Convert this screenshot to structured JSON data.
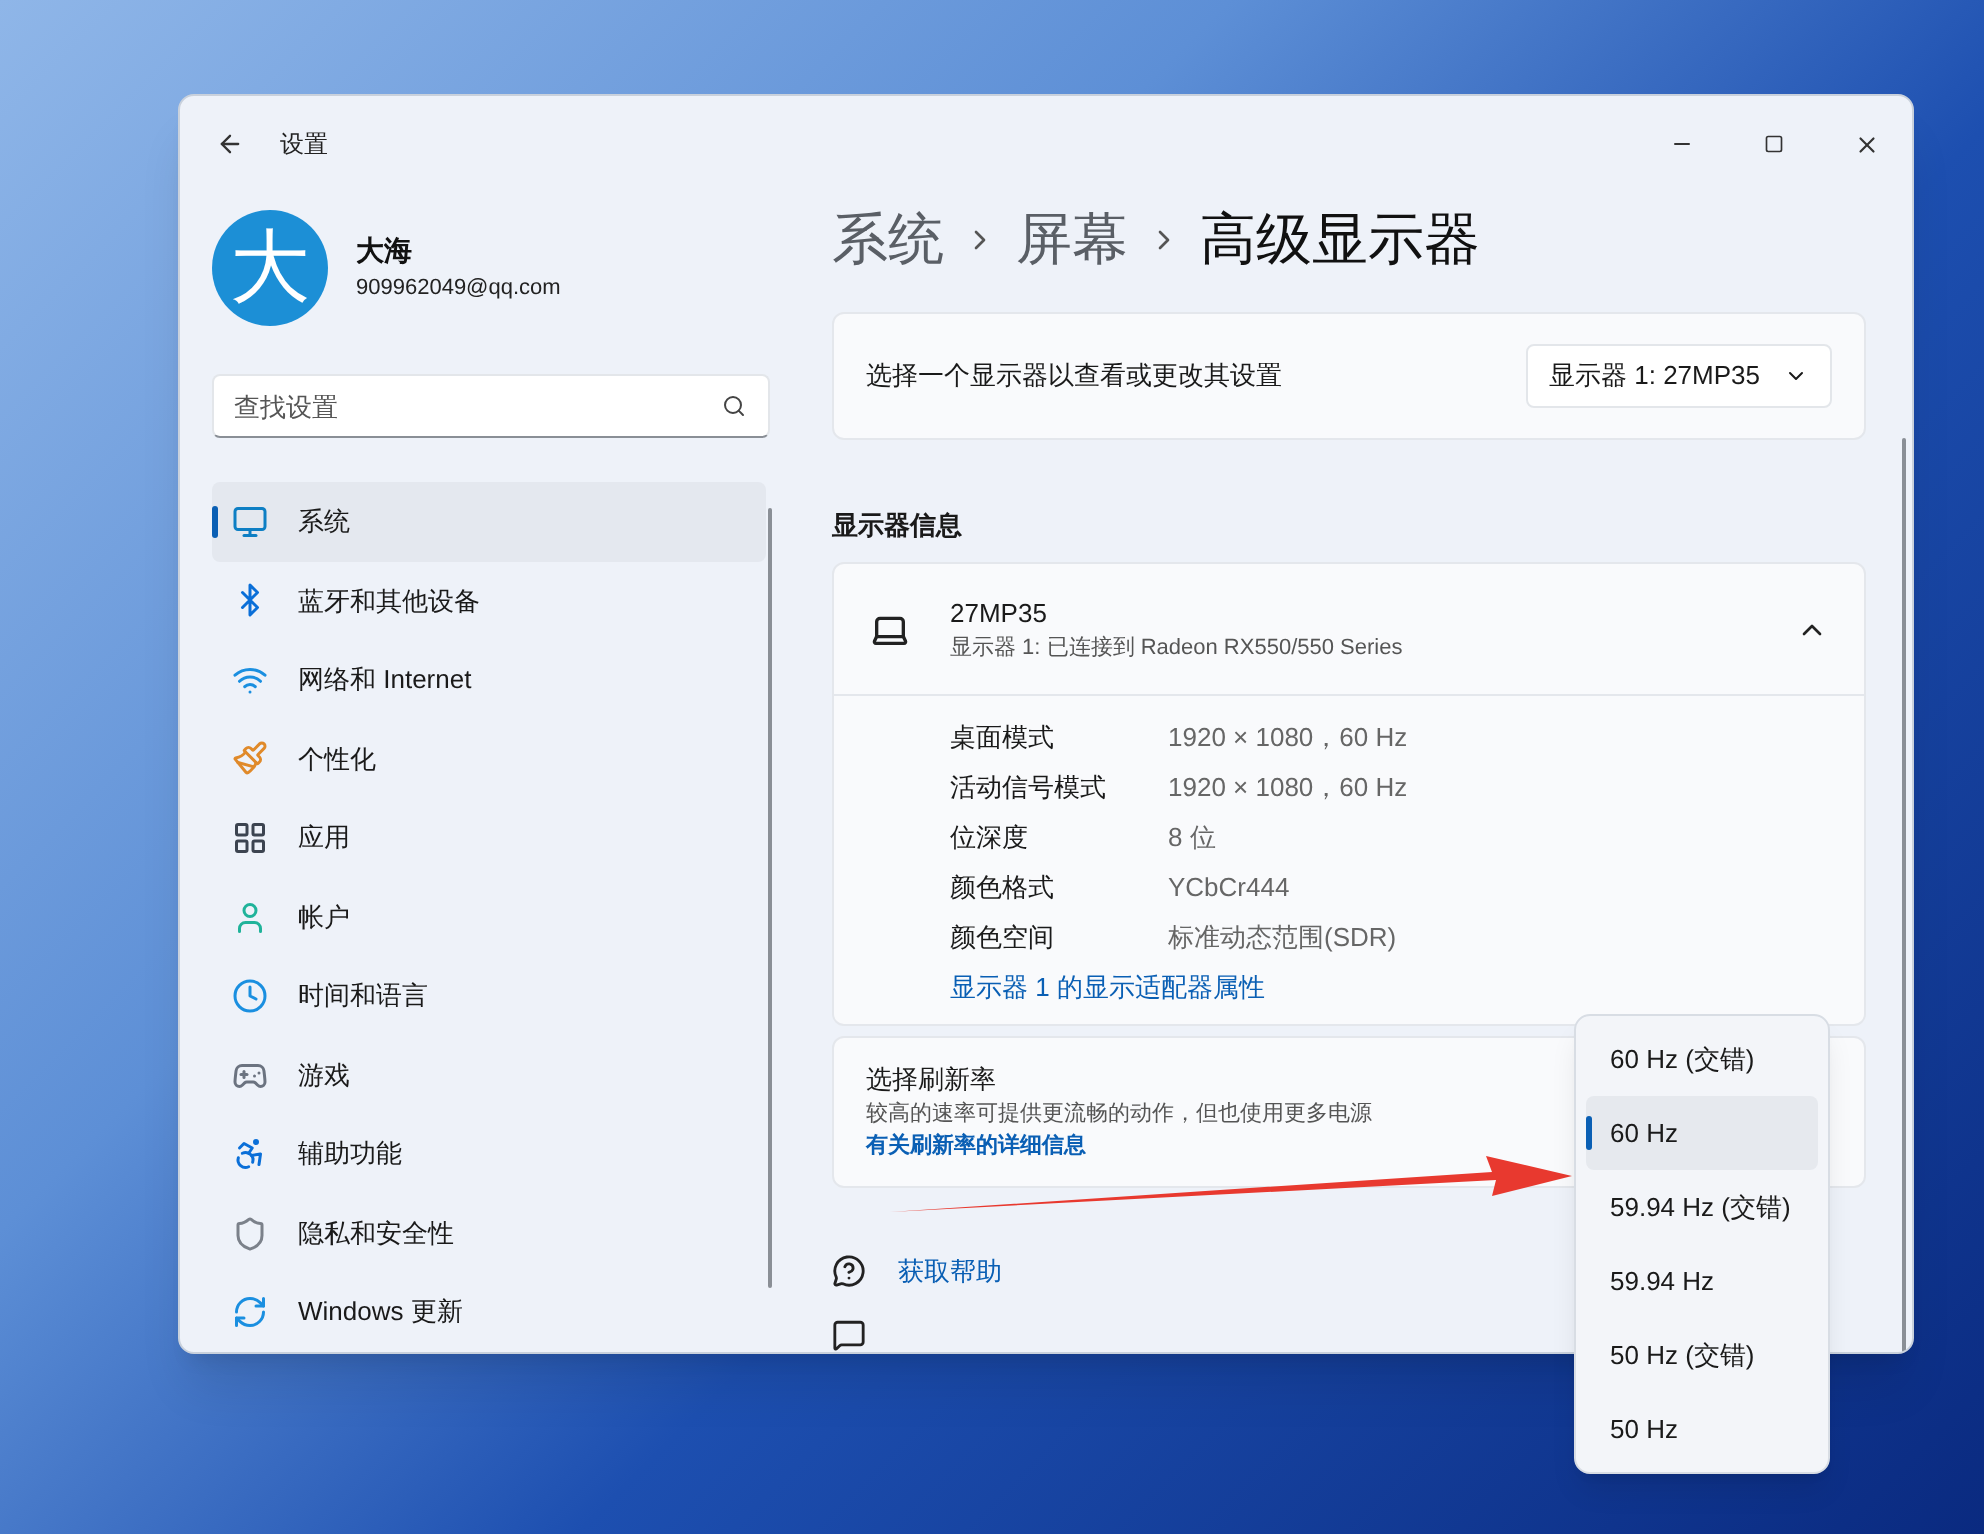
{
  "window": {
    "title": "设置"
  },
  "account": {
    "avatar_text": "大",
    "name": "大海",
    "email": "909962049@qq.com"
  },
  "search": {
    "placeholder": "查找设置"
  },
  "nav": [
    {
      "label": "系统",
      "kind": "system",
      "selected": true
    },
    {
      "label": "蓝牙和其他设备",
      "kind": "bluetooth",
      "selected": false
    },
    {
      "label": "网络和 Internet",
      "kind": "network",
      "selected": false
    },
    {
      "label": "个性化",
      "kind": "personalize",
      "selected": false
    },
    {
      "label": "应用",
      "kind": "apps",
      "selected": false
    },
    {
      "label": "帐户",
      "kind": "accounts",
      "selected": false
    },
    {
      "label": "时间和语言",
      "kind": "time",
      "selected": false
    },
    {
      "label": "游戏",
      "kind": "gaming",
      "selected": false
    },
    {
      "label": "辅助功能",
      "kind": "accessibility",
      "selected": false
    },
    {
      "label": "隐私和安全性",
      "kind": "privacy",
      "selected": false
    },
    {
      "label": "Windows 更新",
      "kind": "update",
      "selected": false
    }
  ],
  "breadcrumb": [
    "系统",
    "屏幕",
    "高级显示器"
  ],
  "display_select": {
    "label": "选择一个显示器以查看或更改其设置",
    "value": "显示器 1: 27MP35"
  },
  "section_title": "显示器信息",
  "display_info": {
    "name": "27MP35",
    "subtitle": "显示器 1: 已连接到 Radeon RX550/550 Series",
    "expanded": true,
    "rows": [
      {
        "label": "桌面模式",
        "value": "1920 × 1080，60 Hz"
      },
      {
        "label": "活动信号模式",
        "value": "1920 × 1080，60 Hz"
      },
      {
        "label": "位深度",
        "value": "8 位"
      },
      {
        "label": "颜色格式",
        "value": "YCbCr444"
      },
      {
        "label": "颜色空间",
        "value": "标准动态范围(SDR)"
      }
    ],
    "link": "显示器 1 的显示适配器属性"
  },
  "refresh": {
    "title": "选择刷新率",
    "description": "较高的速率可提供更流畅的动作，但也使用更多电源",
    "link": "有关刷新率的详细信息"
  },
  "refresh_options": [
    {
      "label": "60 Hz (交错)",
      "selected": false
    },
    {
      "label": "60 Hz",
      "selected": true
    },
    {
      "label": "59.94 Hz (交错)",
      "selected": false
    },
    {
      "label": "59.94 Hz",
      "selected": false
    },
    {
      "label": "50 Hz (交错)",
      "selected": false
    },
    {
      "label": "50 Hz",
      "selected": false
    }
  ],
  "help_link": "获取帮助"
}
